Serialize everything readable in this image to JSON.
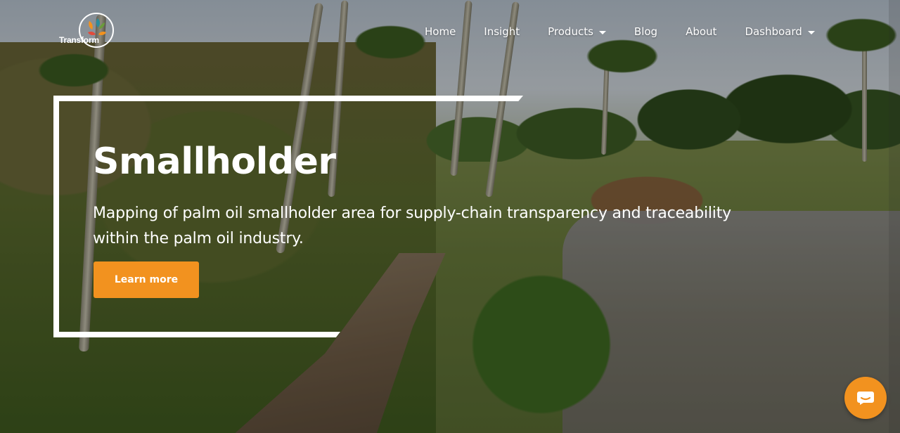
{
  "brand": {
    "name": "Transform",
    "logo_colors": [
      "#f2921f",
      "#2a8c9c",
      "#6a9c3a",
      "#e14b3b"
    ]
  },
  "nav": {
    "items": [
      {
        "label": "Home",
        "has_dropdown": false
      },
      {
        "label": "Insight",
        "has_dropdown": false
      },
      {
        "label": "Products",
        "has_dropdown": true
      },
      {
        "label": "Blog",
        "has_dropdown": false
      },
      {
        "label": "About",
        "has_dropdown": false
      },
      {
        "label": "Dashboard",
        "has_dropdown": true
      }
    ]
  },
  "hero": {
    "title": "Smallholder",
    "subtitle": "Mapping of palm oil smallholder area for supply-chain transparency and traceability within the palm oil industry.",
    "cta_label": "Learn more"
  },
  "chat": {
    "icon": "chat-bubble-icon"
  },
  "colors": {
    "accent": "#f2921f",
    "text": "#ffffff"
  }
}
